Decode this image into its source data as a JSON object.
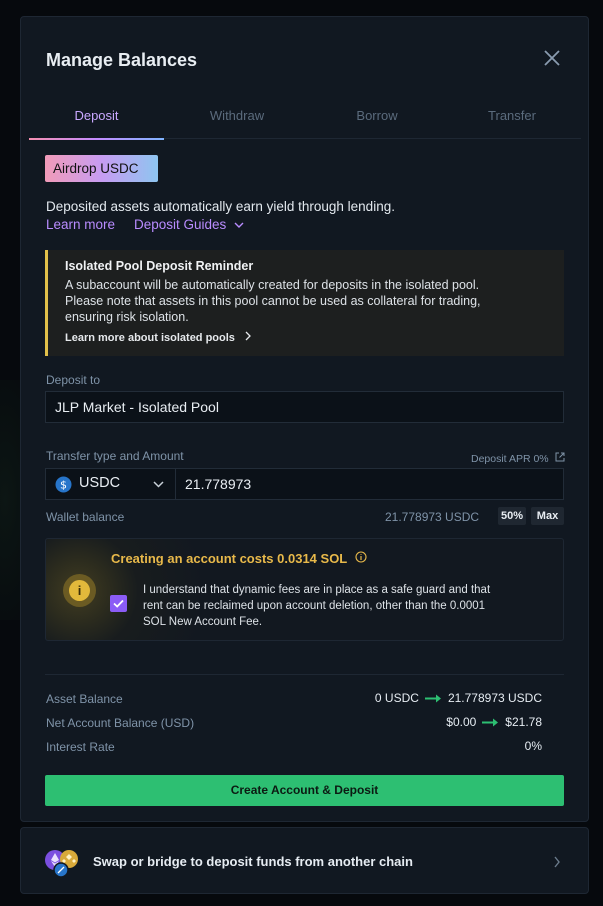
{
  "modal": {
    "title": "Manage Balances",
    "tabs": [
      {
        "label": "Deposit",
        "active": true
      },
      {
        "label": "Withdraw",
        "active": false
      },
      {
        "label": "Borrow",
        "active": false
      },
      {
        "label": "Transfer",
        "active": false
      }
    ],
    "airdrop_label": "Airdrop USDC",
    "description": "Deposited assets automatically earn yield through lending.",
    "learn_more": "Learn more",
    "deposit_guides": "Deposit Guides",
    "reminder": {
      "title": "Isolated Pool Deposit Reminder",
      "lines": [
        "A subaccount will be automatically created for deposits in the isolated pool.",
        "Please note that assets in this pool cannot be used as collateral for trading,",
        "ensuring risk isolation."
      ],
      "link": "Learn more about isolated pools"
    },
    "deposit_to": {
      "label": "Deposit to",
      "value": "JLP Market - Isolated Pool"
    },
    "transfer": {
      "label": "Transfer type and Amount",
      "apr": "Deposit APR 0%",
      "token": "USDC",
      "amount": "21.778973"
    },
    "wallet": {
      "label": "Wallet balance",
      "value": "21.778973 USDC",
      "half": "50%",
      "max": "Max"
    },
    "account_notice": {
      "title": "Creating an account costs 0.0314 SOL",
      "checked": true,
      "lines": [
        "I understand that dynamic fees are in place as a safe guard and that",
        "rent can be reclaimed upon account deletion, other than the 0.0001",
        "SOL New Account Fee."
      ]
    },
    "summary": {
      "asset_balance": {
        "label": "Asset Balance",
        "from": "0 USDC",
        "to": "21.778973 USDC"
      },
      "net_balance": {
        "label": "Net Account Balance (USD)",
        "from": "$0.00",
        "to": "$21.78"
      },
      "interest_rate": {
        "label": "Interest Rate",
        "value": "0%"
      }
    },
    "cta": "Create Account & Deposit"
  },
  "bridge": {
    "text": "Swap or bridge to deposit funds from another chain"
  },
  "colors": {
    "accent_purple": "#b98cff",
    "cta_green": "#2dbf72",
    "warning_yellow": "#e2c04a",
    "arrow_green": "#2dbf72"
  }
}
